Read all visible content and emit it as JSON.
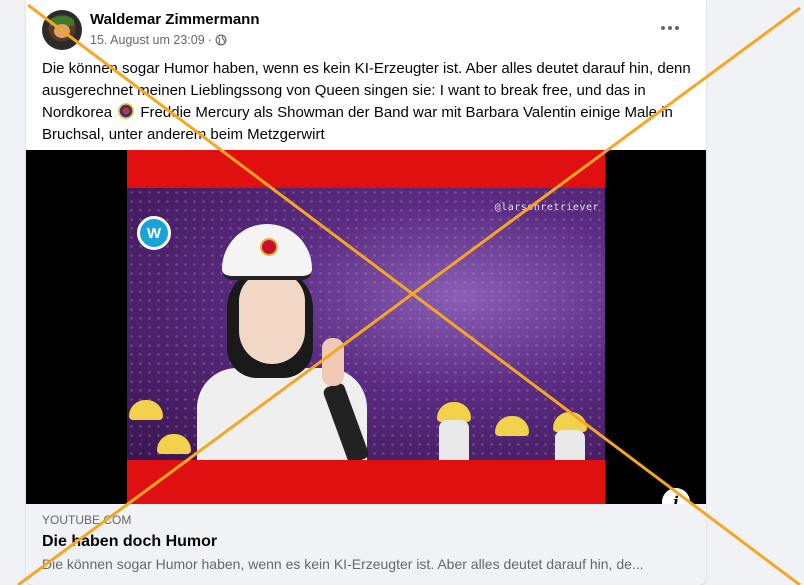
{
  "post": {
    "author": "Waldemar Zimmermann",
    "timestamp": "15. August um 23:09",
    "separator": "·",
    "audience_icon": "globe-icon",
    "text_before_emoji": "Die können sogar Humor haben, wenn es kein KI-Erzeugter ist. Aber alles deutet darauf hin, denn ausgerechnet meinen Lieblingssong von Queen singen sie: I want to break free, und das in Nordkorea",
    "text_after_emoji": "Freddie Mercury als Showman der Band war mit Barbara Valentin einige Male in Bruchsal, unter anderem beim Metzgerwirt",
    "emoji": "north-korea-flag-emoji"
  },
  "video": {
    "watermark": "@larsonretriever",
    "logo_letter": "W"
  },
  "link_preview": {
    "source": "YOUTUBE.COM",
    "title": "Die haben doch Humor",
    "description": "Die können sogar Humor haben, wenn es kein KI-Erzeugter ist. Aber alles deutet darauf hin, de..."
  },
  "colors": {
    "overlay_cross": "#f5a623",
    "video_frame_red": "#e01010",
    "card_bg": "#ffffff",
    "page_bg": "#f0f2f5",
    "secondary_text": "#65676b"
  }
}
